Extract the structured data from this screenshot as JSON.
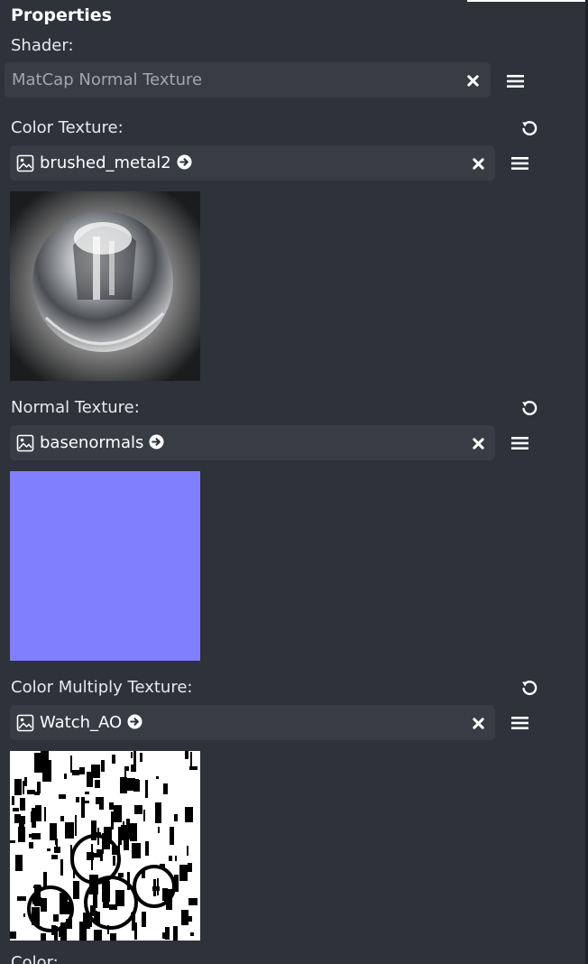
{
  "panel": {
    "title": "Properties",
    "shader_label": "Shader:",
    "shader_value": "MatCap Normal Texture",
    "cutoff_label": "Color:"
  },
  "textures": [
    {
      "label": "Color Texture:",
      "name": "brushed_metal2"
    },
    {
      "label": "Normal Texture:",
      "name": "basenormals",
      "preview_color": "#8080ff"
    },
    {
      "label": "Color Multiply Texture:",
      "name": "Watch_AO"
    }
  ],
  "icons": {
    "image": "image-icon",
    "goto": "circle-arrow-right-icon",
    "clear": "close-icon",
    "menu": "hamburger-menu-icon",
    "reset": "reset-icon"
  },
  "colors": {
    "background": "#2e323a",
    "field": "#383c44",
    "placeholder_text": "#a2a6ad",
    "normal_map": "#8080ff"
  }
}
